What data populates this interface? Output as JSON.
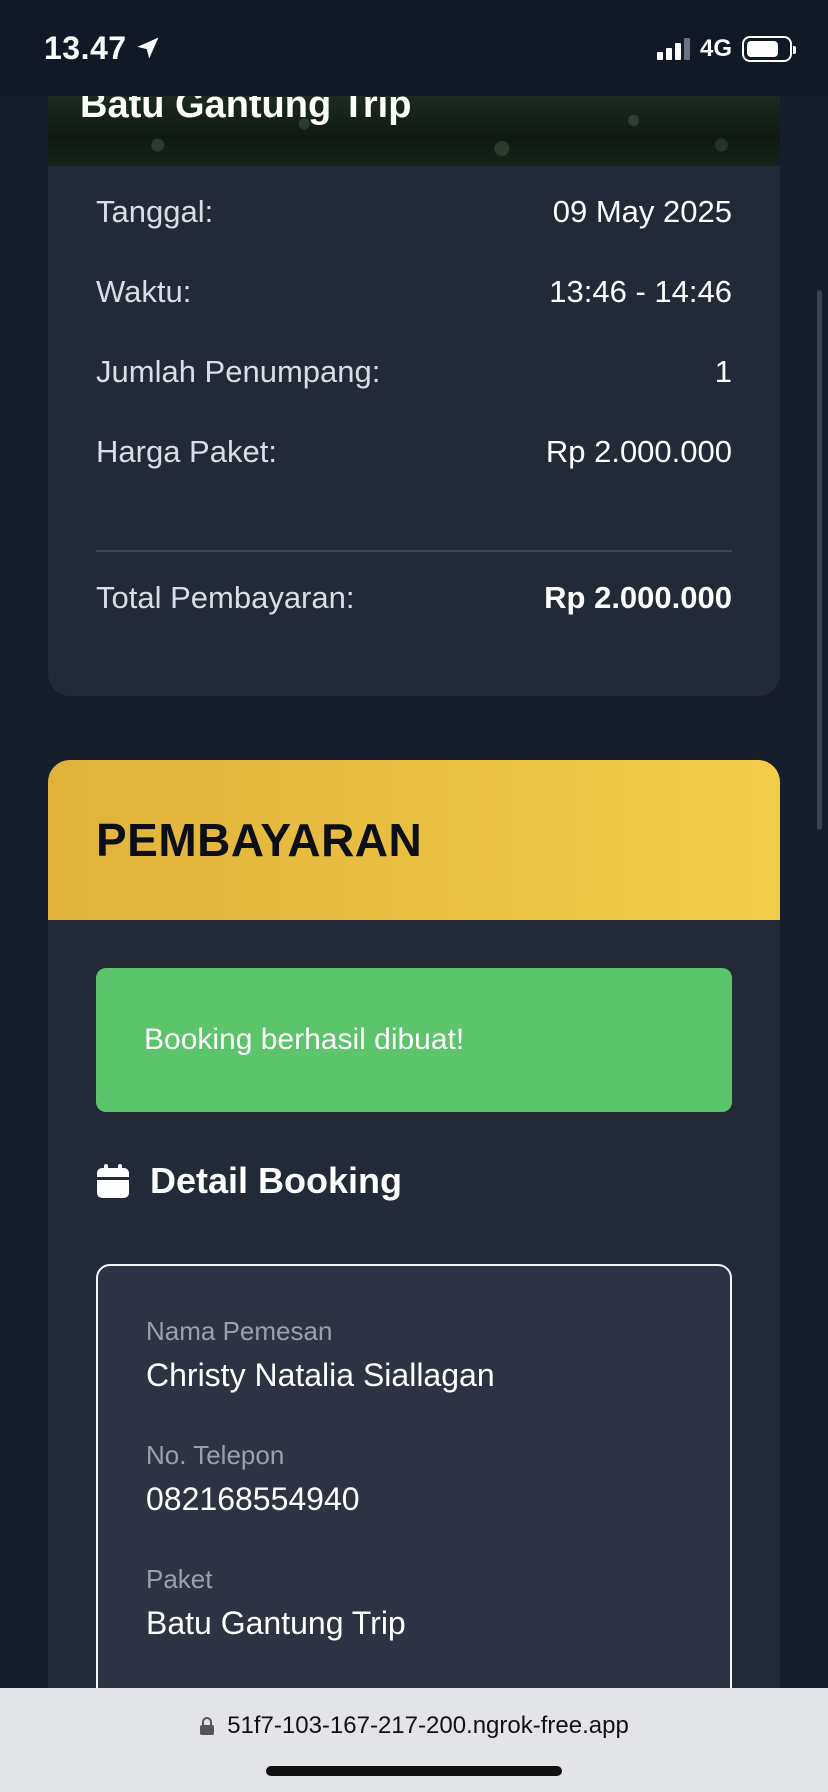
{
  "status_bar": {
    "time": "13.47",
    "network": "4G"
  },
  "hero": {
    "title": "Batu Gantung Trip"
  },
  "summary": {
    "rows": [
      {
        "label": "Tanggal:",
        "value": "09 May 2025"
      },
      {
        "label": "Waktu:",
        "value": "13:46 - 14:46"
      },
      {
        "label": "Jumlah Penumpang:",
        "value": "1"
      },
      {
        "label": "Harga Paket:",
        "value": "Rp 2.000.000"
      }
    ],
    "total_label": "Total Pembayaran:",
    "total_value": "Rp 2.000.000"
  },
  "payment": {
    "title": "PEMBAYARAN",
    "alert": "Booking berhasil dibuat!",
    "section_title": "Detail Booking",
    "fields": [
      {
        "label": "Nama Pemesan",
        "value": "Christy Natalia Siallagan"
      },
      {
        "label": "No. Telepon",
        "value": "082168554940"
      },
      {
        "label": "Paket",
        "value": "Batu Gantung Trip"
      }
    ]
  },
  "browser": {
    "url": "51f7-103-167-217-200.ngrok-free.app"
  },
  "colors": {
    "accent": "#f2c94c",
    "success": "#5cc46a",
    "card_bg": "#222937",
    "page_bg": "#161d2b"
  }
}
